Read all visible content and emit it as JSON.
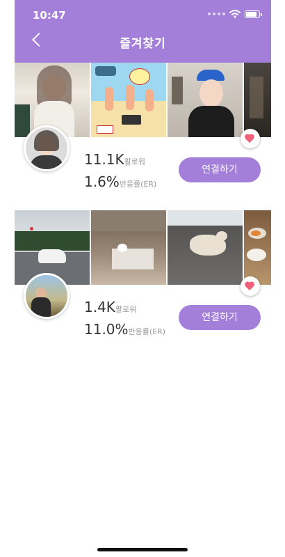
{
  "status": {
    "time": "10:47"
  },
  "header": {
    "title": "즐겨찾기"
  },
  "cards": [
    {
      "followers": "11.1K",
      "followers_label": "팔로워",
      "engagement": "1.6%",
      "engagement_label": "반응률(ER)",
      "connect_label": "연결하기"
    },
    {
      "followers": "1.4K",
      "followers_label": "팔로워",
      "engagement": "11.0%",
      "engagement_label": "반응률(ER)",
      "connect_label": "연결하기"
    }
  ],
  "colors": {
    "accent": "#a47fda",
    "heart": "#f0607a"
  },
  "icons": [
    "back-chevron-icon",
    "wifi-icon",
    "battery-icon",
    "heart-icon"
  ]
}
